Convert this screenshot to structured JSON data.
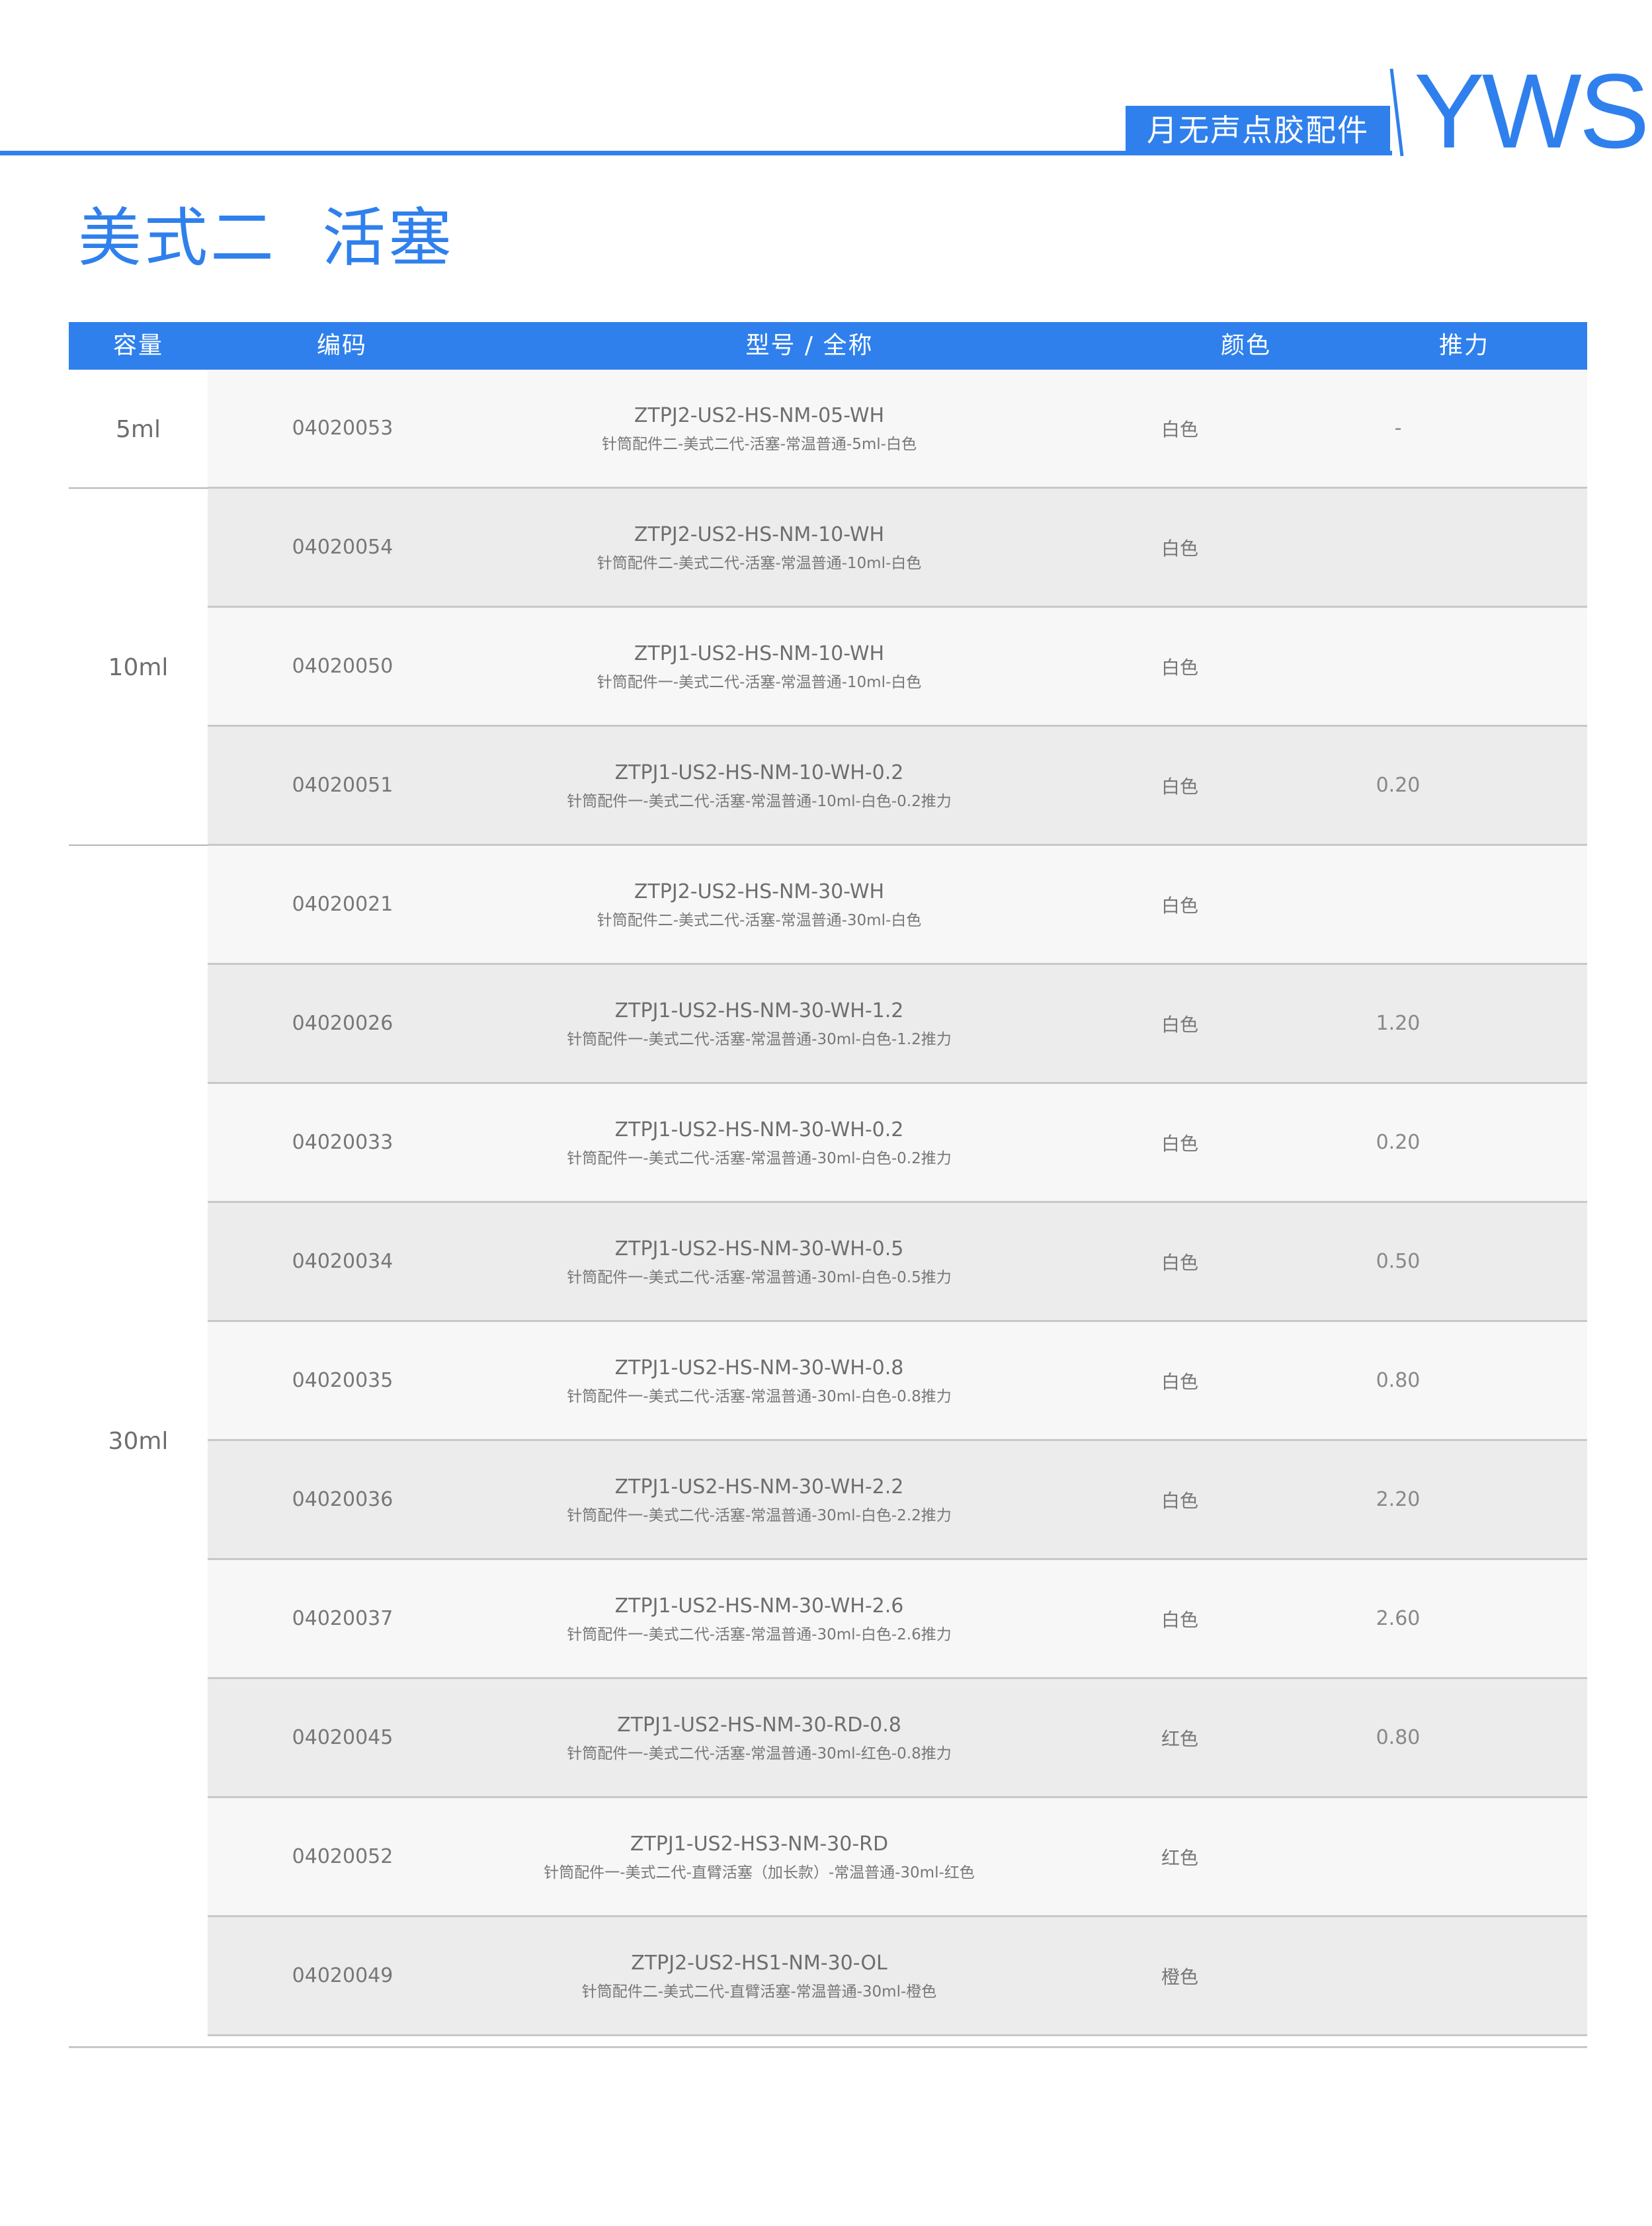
{
  "header": {
    "brand_tab": "月无声点胶配件",
    "logo": "YWS",
    "accent_color": "#2f80ed"
  },
  "page_title": "美式二  活塞",
  "table": {
    "columns": [
      "容量",
      "编码",
      "型号 / 全称",
      "颜色",
      "推力"
    ],
    "groups": [
      {
        "capacity": "5ml",
        "rows": [
          {
            "code": "04020053",
            "model": "ZTPJ2-US2-HS-NM-05-WH",
            "name": "针筒配件二-美式二代-活塞-常温普通-5ml-白色",
            "color": "白色",
            "push": "-"
          }
        ]
      },
      {
        "capacity": "10ml",
        "rows": [
          {
            "code": "04020054",
            "model": "ZTPJ2-US2-HS-NM-10-WH",
            "name": "针筒配件二-美式二代-活塞-常温普通-10ml-白色",
            "color": "白色",
            "push": ""
          },
          {
            "code": "04020050",
            "model": "ZTPJ1-US2-HS-NM-10-WH",
            "name": "针筒配件一-美式二代-活塞-常温普通-10ml-白色",
            "color": "白色",
            "push": ""
          },
          {
            "code": "04020051",
            "model": "ZTPJ1-US2-HS-NM-10-WH-0.2",
            "name": "针筒配件一-美式二代-活塞-常温普通-10ml-白色-0.2推力",
            "color": "白色",
            "push": "0.20"
          }
        ]
      },
      {
        "capacity": "30ml",
        "rows": [
          {
            "code": "04020021",
            "model": "ZTPJ2-US2-HS-NM-30-WH",
            "name": "针筒配件二-美式二代-活塞-常温普通-30ml-白色",
            "color": "白色",
            "push": ""
          },
          {
            "code": "04020026",
            "model": "ZTPJ1-US2-HS-NM-30-WH-1.2",
            "name": "针筒配件一-美式二代-活塞-常温普通-30ml-白色-1.2推力",
            "color": "白色",
            "push": "1.20"
          },
          {
            "code": "04020033",
            "model": "ZTPJ1-US2-HS-NM-30-WH-0.2",
            "name": "针筒配件一-美式二代-活塞-常温普通-30ml-白色-0.2推力",
            "color": "白色",
            "push": "0.20"
          },
          {
            "code": "04020034",
            "model": "ZTPJ1-US2-HS-NM-30-WH-0.5",
            "name": "针筒配件一-美式二代-活塞-常温普通-30ml-白色-0.5推力",
            "color": "白色",
            "push": "0.50"
          },
          {
            "code": "04020035",
            "model": "ZTPJ1-US2-HS-NM-30-WH-0.8",
            "name": "针筒配件一-美式二代-活塞-常温普通-30ml-白色-0.8推力",
            "color": "白色",
            "push": "0.80"
          },
          {
            "code": "04020036",
            "model": "ZTPJ1-US2-HS-NM-30-WH-2.2",
            "name": "针筒配件一-美式二代-活塞-常温普通-30ml-白色-2.2推力",
            "color": "白色",
            "push": "2.20"
          },
          {
            "code": "04020037",
            "model": "ZTPJ1-US2-HS-NM-30-WH-2.6",
            "name": "针筒配件一-美式二代-活塞-常温普通-30ml-白色-2.6推力",
            "color": "白色",
            "push": "2.60"
          },
          {
            "code": "04020045",
            "model": "ZTPJ1-US2-HS-NM-30-RD-0.8",
            "name": "针筒配件一-美式二代-活塞-常温普通-30ml-红色-0.8推力",
            "color": "红色",
            "push": "0.80"
          },
          {
            "code": "04020052",
            "model": "ZTPJ1-US2-HS3-NM-30-RD",
            "name": "针筒配件一-美式二代-直臂活塞（加长款）-常温普通-30ml-红色",
            "color": "红色",
            "push": ""
          },
          {
            "code": "04020049",
            "model": "ZTPJ2-US2-HS1-NM-30-OL",
            "name": "针筒配件二-美式二代-直臂活塞-常温普通-30ml-橙色",
            "color": "橙色",
            "push": ""
          }
        ]
      }
    ]
  }
}
